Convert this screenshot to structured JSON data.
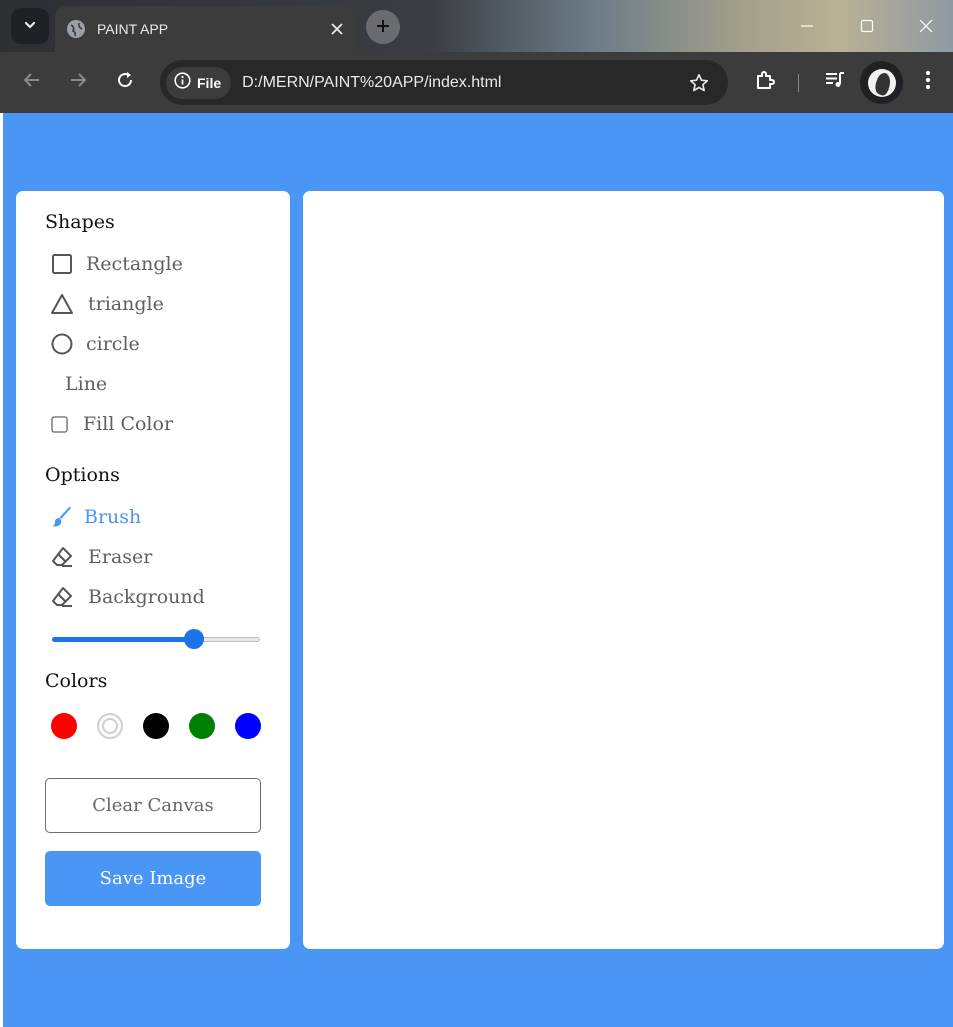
{
  "browser": {
    "tab_title": "PAINT APP",
    "site_chip_label": "File",
    "url": "D:/MERN/PAINT%20APP/index.html"
  },
  "panel": {
    "shapes_title": "Shapes",
    "shapes": [
      {
        "label": "Rectangle",
        "icon": "square-outline-icon"
      },
      {
        "label": "triangle",
        "icon": "triangle-outline-icon"
      },
      {
        "label": "circle",
        "icon": "circle-outline-icon"
      },
      {
        "label": "Line",
        "icon": ""
      }
    ],
    "fill_color_label": "Fill Color",
    "fill_color_checked": false,
    "options_title": "Options",
    "options": [
      {
        "label": "Brush",
        "icon": "brush-icon",
        "active": true
      },
      {
        "label": "Eraser",
        "icon": "eraser-icon",
        "active": false
      },
      {
        "label": "Background",
        "icon": "eraser-icon",
        "active": false
      }
    ],
    "brush_size_fraction": 0.7,
    "colors_title": "Colors",
    "colors": [
      "#ff0000",
      "#ffffff",
      "#000000",
      "#008000",
      "#0000ff"
    ],
    "selected_color_index": 1,
    "clear_button": "Clear Canvas",
    "save_button": "Save Image"
  },
  "theme": {
    "accent": "#4a96f5",
    "slider": "#1a73e8"
  }
}
